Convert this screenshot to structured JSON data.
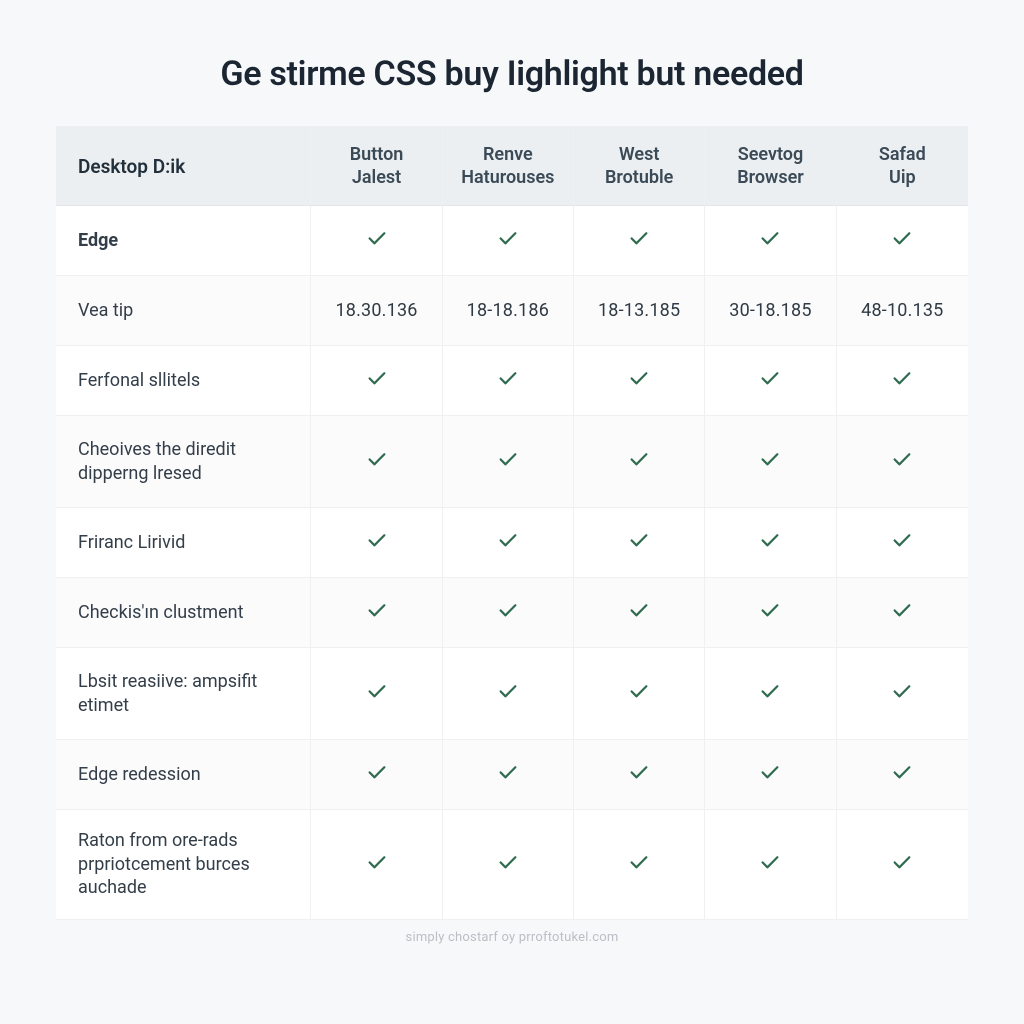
{
  "title": "Ge stirme CSS buy Iighlight but needed",
  "footer": "simply chostarf oy prroftotukel.com",
  "checkColor": "#2f6b4f",
  "table": {
    "header": {
      "feature": "Desktop D:ik",
      "columns": [
        {
          "line1": "Button",
          "line2": "Jalest"
        },
        {
          "line1": "Renve",
          "line2": "Haturouses"
        },
        {
          "line1": "West",
          "line2": "Brotuble"
        },
        {
          "line1": "Seevtog",
          "line2": "Browser"
        },
        {
          "line1": "Safad",
          "line2": "Uip"
        }
      ]
    },
    "rows": [
      {
        "feature": "Edge",
        "strong": true,
        "cells": [
          "check",
          "check",
          "check",
          "check",
          "check"
        ]
      },
      {
        "feature": "Vea tip",
        "cells": [
          "18.30.136",
          "18-18.186",
          "18-13.185",
          "30-18.185",
          "48-10.135"
        ],
        "numeric": true
      },
      {
        "feature": "Ferfonal sllitels",
        "cells": [
          "check",
          "check",
          "check",
          "check",
          "check"
        ]
      },
      {
        "feature": "Cheoives the diredit dipperng lresed",
        "cells": [
          "check",
          "check",
          "check",
          "check",
          "check"
        ],
        "tall": true
      },
      {
        "feature": "Friranc Lirivid",
        "cells": [
          "check",
          "check",
          "check",
          "check",
          "check"
        ]
      },
      {
        "feature": "Checkis'ın clustment",
        "cells": [
          "check",
          "check",
          "check",
          "check",
          "check"
        ]
      },
      {
        "feature": "Lbsit reasiive: ampsifit etimet",
        "cells": [
          "check",
          "check",
          "check",
          "check",
          "check"
        ],
        "tall": true
      },
      {
        "feature": "Edge redession",
        "cells": [
          "check",
          "check",
          "check",
          "check",
          "check"
        ]
      },
      {
        "feature": "Raton from ore-rads prpriotcement burces auchade",
        "cells": [
          "check",
          "check",
          "check",
          "check",
          "check"
        ],
        "xtall": true
      }
    ]
  }
}
